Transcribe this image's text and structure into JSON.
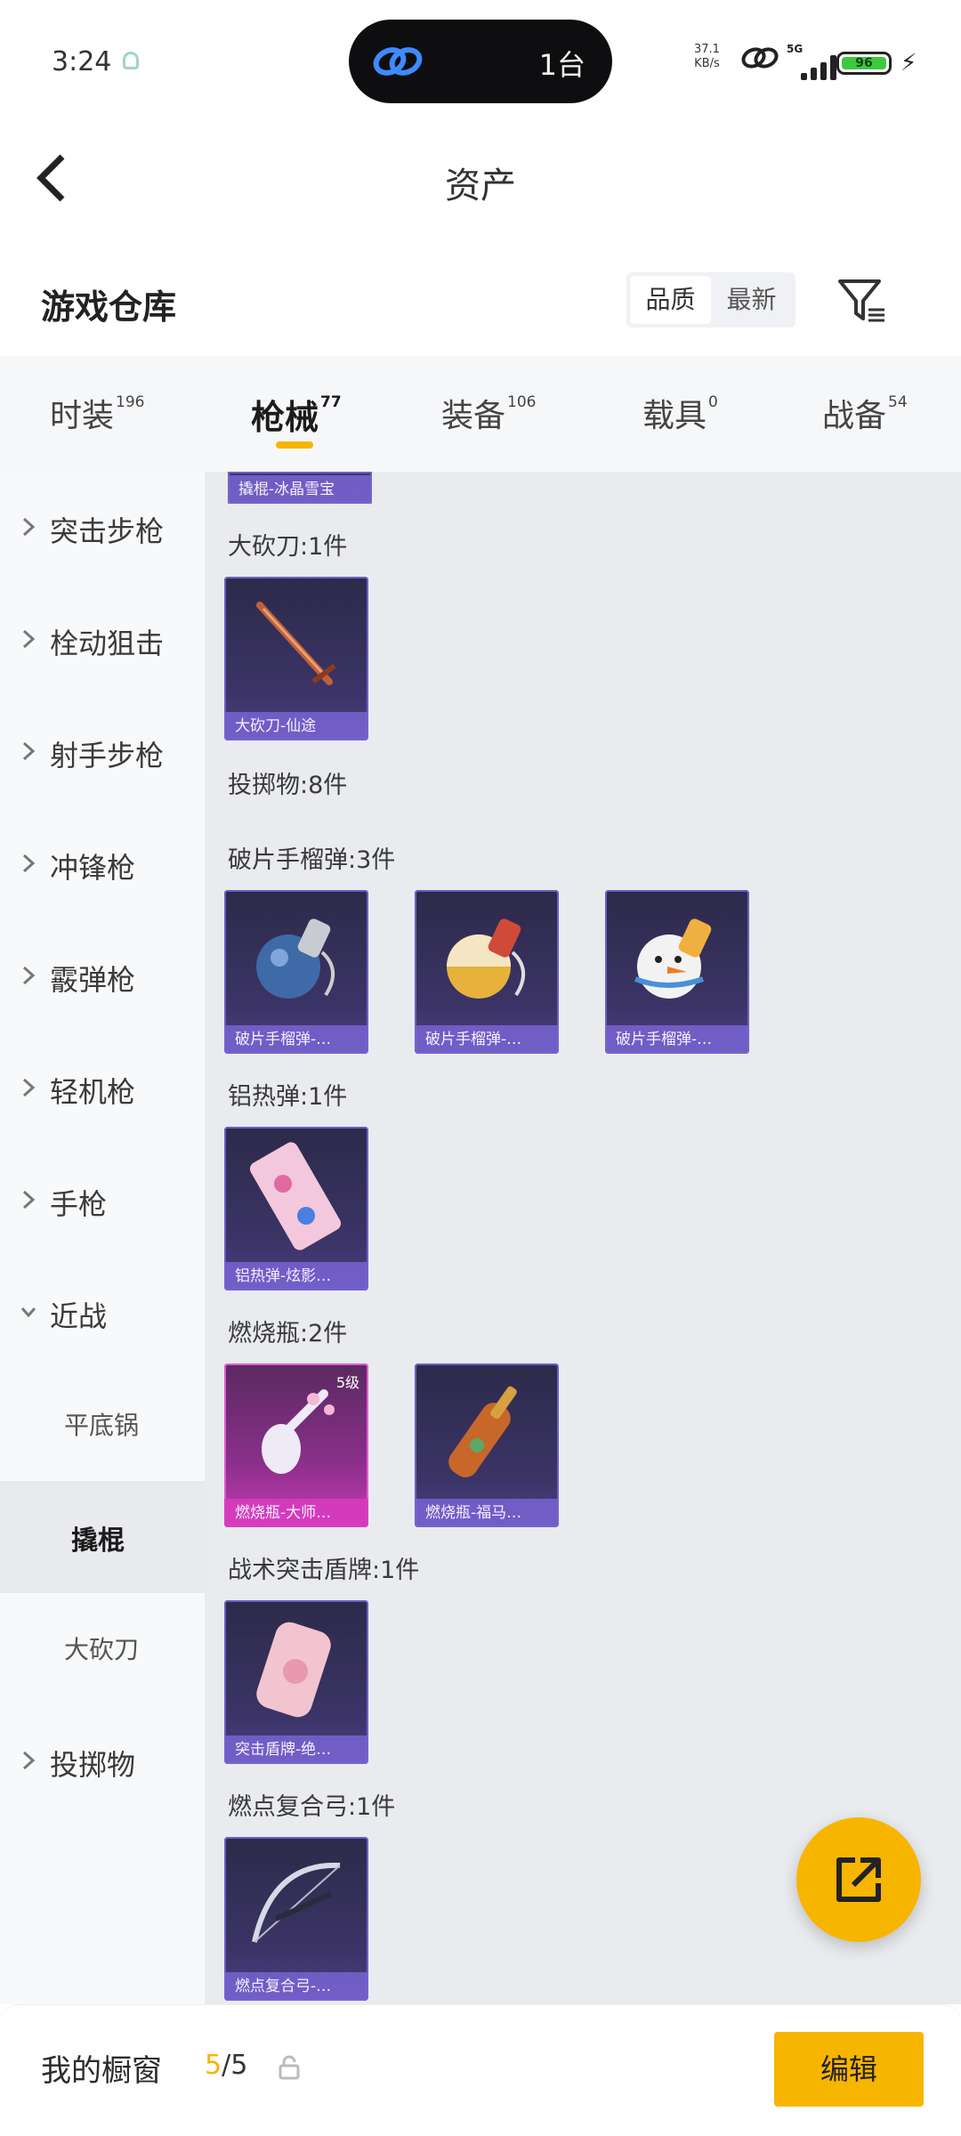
{
  "status_bar": {
    "time": "3:24",
    "island_text": "1台",
    "net_speed": "37.1\nKB/s",
    "network": "5G",
    "battery": "96"
  },
  "header": {
    "title": "资产"
  },
  "section": {
    "title": "游戏仓库",
    "sort_options": [
      "品质",
      "最新"
    ],
    "active_sort": "品质"
  },
  "tabs": [
    {
      "label": "时装",
      "count": "196"
    },
    {
      "label": "枪械",
      "count": "77"
    },
    {
      "label": "装备",
      "count": "106"
    },
    {
      "label": "载具",
      "count": "0"
    },
    {
      "label": "战备",
      "count": "54"
    }
  ],
  "active_tab": "枪械",
  "sidebar": {
    "items": [
      {
        "label": "突击步枪"
      },
      {
        "label": "栓动狙击"
      },
      {
        "label": "射手步枪"
      },
      {
        "label": "冲锋枪"
      },
      {
        "label": "霰弹枪"
      },
      {
        "label": "轻机枪"
      },
      {
        "label": "手枪"
      },
      {
        "label": "近战"
      }
    ],
    "sub_items": [
      {
        "label": "平底锅"
      },
      {
        "label": "撬棍"
      },
      {
        "label": "大砍刀"
      }
    ],
    "last_item": {
      "label": "投掷物"
    },
    "selected": "撬棍"
  },
  "content": {
    "top_card_caption": "撬棍-冰晶雪宝",
    "groups": [
      {
        "label": "大砍刀:1件",
        "cards": [
          {
            "caption": "大砍刀-仙途",
            "style": "purple",
            "art": "sword"
          }
        ]
      },
      {
        "label": "投掷物:8件",
        "cards": []
      },
      {
        "label": "破片手榴弹:3件",
        "cards": [
          {
            "caption": "破片手榴弹-…",
            "style": "purple",
            "art": "grenade-blue"
          },
          {
            "caption": "破片手榴弹-…",
            "style": "purple",
            "art": "grenade-gold"
          },
          {
            "caption": "破片手榴弹-…",
            "style": "purple",
            "art": "grenade-snow"
          }
        ]
      },
      {
        "label": "铝热弹:1件",
        "cards": [
          {
            "caption": "铝热弹-炫影…",
            "style": "purple",
            "art": "thermite"
          }
        ]
      },
      {
        "label": "燃烧瓶:2件",
        "cards": [
          {
            "caption": "燃烧瓶-大师…",
            "style": "pink",
            "art": "vase",
            "grade": "5级"
          },
          {
            "caption": "燃烧瓶-福马…",
            "style": "purple",
            "art": "bottle"
          }
        ]
      },
      {
        "label": "战术突击盾牌:1件",
        "cards": [
          {
            "caption": "突击盾牌-绝…",
            "style": "purple",
            "art": "shield"
          }
        ]
      },
      {
        "label": "燃点复合弓:1件",
        "cards": [
          {
            "caption": "燃点复合弓-…",
            "style": "purple",
            "art": "bow"
          }
        ]
      }
    ]
  },
  "bottom": {
    "showcase_label": "我的橱窗",
    "showcase_used": "5",
    "showcase_total": "/5",
    "edit_label": "编辑"
  },
  "colors": {
    "accent": "#f7b500",
    "card_purple": "#3b3466",
    "card_pink": "#c93ab6"
  }
}
